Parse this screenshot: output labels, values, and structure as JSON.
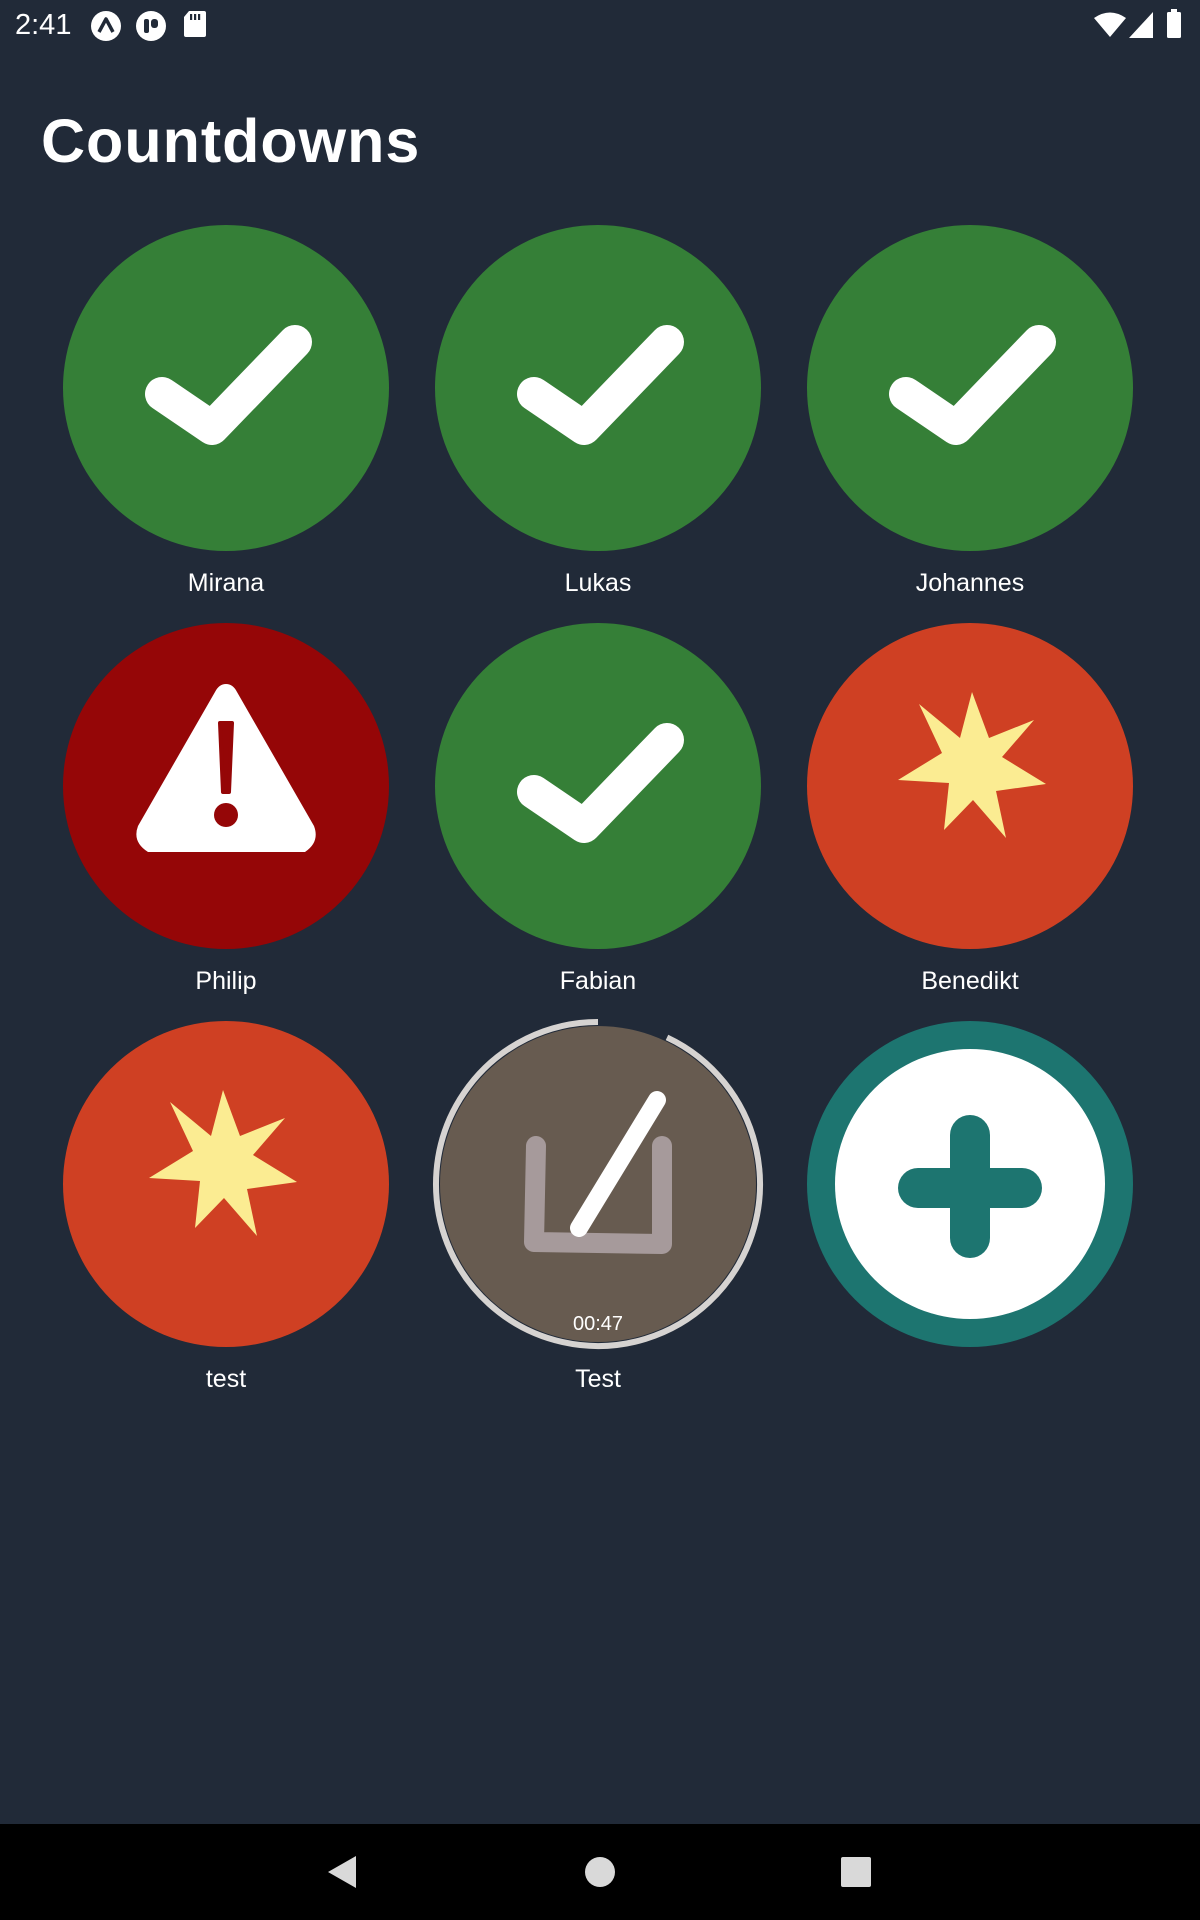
{
  "status_bar": {
    "time": "2:41",
    "left_icons": [
      "expo-icon",
      "app-icon",
      "sd-card-icon"
    ],
    "right_icons": [
      "wifi-icon",
      "signal-icon",
      "battery-icon"
    ]
  },
  "page": {
    "title": "Countdowns"
  },
  "countdowns": [
    {
      "name": "Mirana",
      "state": "done",
      "icon": "checkmark-icon",
      "color": "#357f37"
    },
    {
      "name": "Lukas",
      "state": "done",
      "icon": "checkmark-icon",
      "color": "#357f37"
    },
    {
      "name": "Johannes",
      "state": "done",
      "icon": "checkmark-icon",
      "color": "#357f37"
    },
    {
      "name": "Philip",
      "state": "error",
      "icon": "warning-icon",
      "color": "#950607"
    },
    {
      "name": "Fabian",
      "state": "done",
      "icon": "checkmark-icon",
      "color": "#357f37"
    },
    {
      "name": "Benedikt",
      "state": "expired",
      "icon": "burst-icon",
      "color": "#cf4023"
    },
    {
      "name": "test",
      "state": "expired",
      "icon": "burst-icon",
      "color": "#cf4023"
    },
    {
      "name": "Test",
      "state": "running",
      "icon": "edit-icon",
      "color": "#675b50",
      "remaining": "00:47",
      "progress": 0.93
    }
  ],
  "add_button": {
    "icon": "plus-icon",
    "color": "#1d7570"
  },
  "nav_bar": {
    "buttons": [
      "back-icon",
      "home-icon",
      "recents-icon"
    ]
  }
}
